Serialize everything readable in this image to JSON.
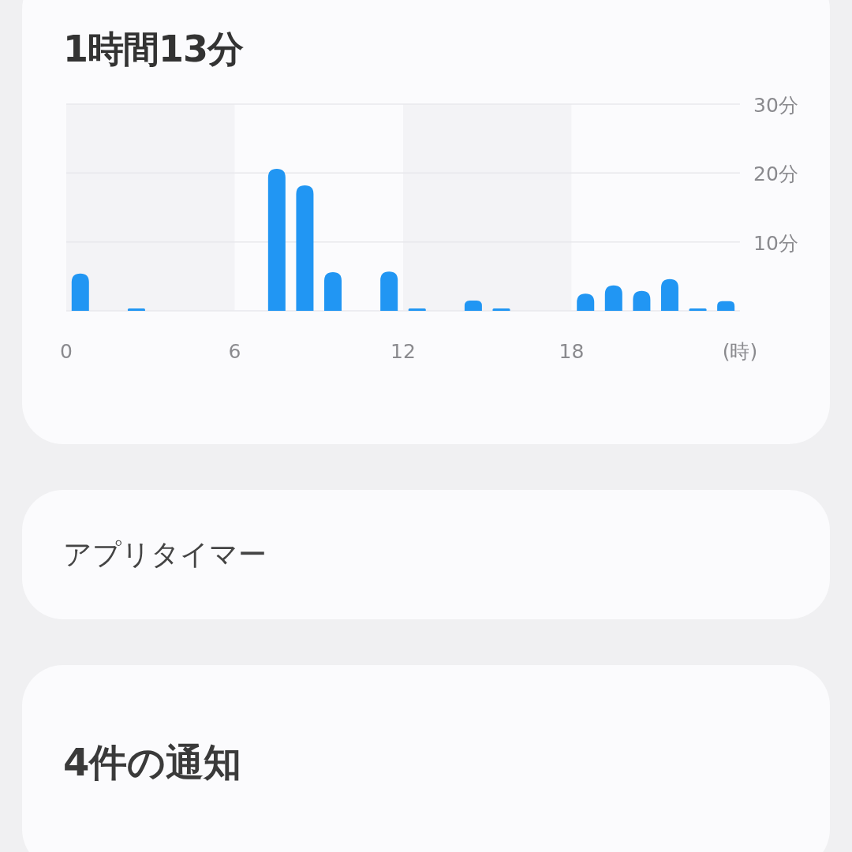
{
  "screen_time": {
    "total": "1時間13分",
    "chart_data": {
      "type": "bar",
      "xlabel": "(時)",
      "x": [
        0.5,
        2.5,
        7.5,
        8.5,
        9.5,
        11.5,
        12.5,
        14.5,
        15.5,
        18.5,
        19.5,
        20.5,
        21.5,
        22.5,
        23.5
      ],
      "xlim": [
        0,
        24
      ],
      "series": [
        {
          "color": "#2196f3",
          "values": [
            5.4,
            0.2,
            20.6,
            18.2,
            5.6,
            5.7,
            0.2,
            1.5,
            0.3,
            2.5,
            3.7,
            2.9,
            4.6,
            0.2,
            1.4
          ]
        }
      ],
      "ylim": [
        0,
        30
      ],
      "yticks": [
        {
          "value": 10,
          "label": "10分"
        },
        {
          "value": 20,
          "label": "20分"
        },
        {
          "value": 30,
          "label": "30分"
        }
      ],
      "xticks": [
        0,
        6,
        12,
        18
      ]
    }
  },
  "app_timer": {
    "label": "アプリタイマー"
  },
  "notifications": {
    "title": "4件の通知"
  }
}
